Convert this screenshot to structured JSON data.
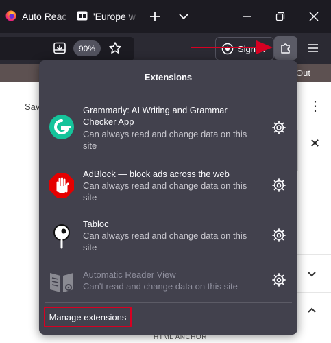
{
  "tabs": [
    {
      "title": "Auto Reac",
      "icon": "firefox-icon"
    },
    {
      "title": "'Europe w",
      "icon": "site-favicon-icon"
    }
  ],
  "toolbar": {
    "zoom_level": "90%",
    "sign_in_label": "Sign in"
  },
  "page": {
    "logout_label": "Out",
    "save_label": "Sav",
    "anchor_label": "HTML ANCHOR"
  },
  "panel": {
    "title": "Extensions",
    "items": [
      {
        "name": "Grammarly: AI Writing and Grammar Checker App",
        "permission": "Can always read and change data on this site",
        "icon": "grammarly-icon",
        "enabled": true
      },
      {
        "name": "AdBlock — block ads across the web",
        "permission": "Can always read and change data on this site",
        "icon": "adblock-hand-icon",
        "enabled": true
      },
      {
        "name": "Tabloc",
        "permission": "Can always read and change data on this site",
        "icon": "tabloc-pin-icon",
        "enabled": true
      },
      {
        "name": "Automatic Reader View",
        "permission": "Can't read and change data on this site",
        "icon": "reader-view-icon",
        "enabled": false
      }
    ],
    "manage_label": "Manage extensions"
  },
  "colors": {
    "accent_red": "#d70022",
    "panel_bg": "#42414d",
    "toolbar_bg": "#2b2a33",
    "tabbar_bg": "#1c1b22",
    "grammarly_green": "#15c39a",
    "adblock_red": "#e40000"
  }
}
